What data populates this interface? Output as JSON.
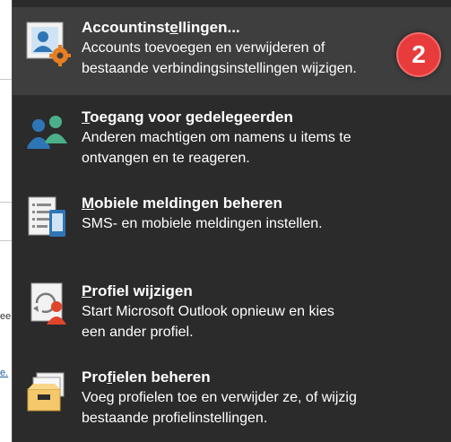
{
  "background": {
    "fragment_ee": "ee",
    "fragment_link": "e."
  },
  "menu": {
    "items": [
      {
        "title_pre": "Accountinst",
        "title_key": "e",
        "title_post": "llingen...",
        "description_line1": "Accounts toevoegen en verwijderen of",
        "description_line2": "bestaande verbindingsinstellingen wijzigen."
      },
      {
        "title_pre": "",
        "title_key": "T",
        "title_post": "oegang voor gedelegeerden",
        "description_line1": "Anderen machtigen om namens u items te",
        "description_line2": "ontvangen en te reageren."
      },
      {
        "title_pre": "",
        "title_key": "M",
        "title_post": "obiele meldingen beheren",
        "description_line1": "SMS- en mobiele meldingen instellen.",
        "description_line2": ""
      },
      {
        "title_pre": "",
        "title_key": "P",
        "title_post": "rofiel wijzigen",
        "description_line1": "Start  Microsoft Outlook opnieuw en kies",
        "description_line2": "een ander profiel."
      },
      {
        "title_pre": "Pro",
        "title_key": "f",
        "title_post": "ielen beheren",
        "description_line1": "Voeg profielen toe en verwijder ze, of wijzig",
        "description_line2": "bestaande profielinstellingen."
      }
    ]
  },
  "step_badge": "2"
}
